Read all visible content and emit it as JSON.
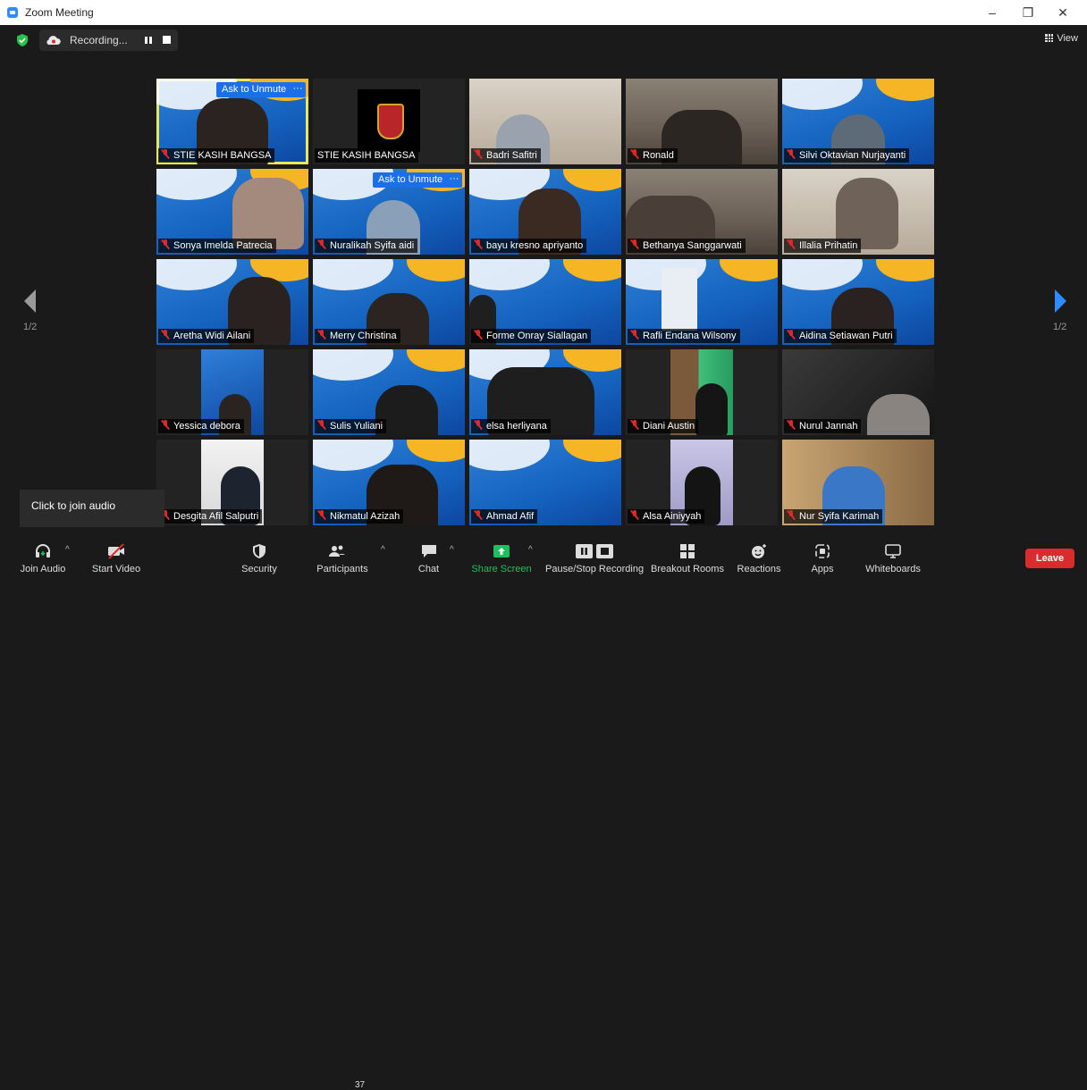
{
  "window": {
    "title": "Zoom Meeting",
    "controls": [
      "–",
      "❐",
      "✕"
    ]
  },
  "topbar": {
    "recording_label": "Recording...",
    "view_label": "View"
  },
  "pagination": {
    "left": "1/2",
    "right": "1/2"
  },
  "ask_to_unmute": "Ask to Unmute",
  "more": "···",
  "participants": [
    {
      "name": "STIE KASIH BANGSA",
      "muted": true
    },
    {
      "name": "STIE KASIH BANGSA",
      "muted": false
    },
    {
      "name": "Badri Safitri",
      "muted": true
    },
    {
      "name": "Ronald",
      "muted": true
    },
    {
      "name": "Silvi Oktavian Nurjayanti",
      "muted": true
    },
    {
      "name": "Sonya Imelda Patrecia",
      "muted": true
    },
    {
      "name": "Nuralikah Syifa aidi",
      "muted": true
    },
    {
      "name": "bayu kresno apriyanto",
      "muted": true
    },
    {
      "name": "Bethanya Sanggarwati",
      "muted": true
    },
    {
      "name": "Illalia Prihatin",
      "muted": true
    },
    {
      "name": "Aretha Widi Ailani",
      "muted": true
    },
    {
      "name": "Merry Christina",
      "muted": true
    },
    {
      "name": "Forme Onray Siallagan",
      "muted": true
    },
    {
      "name": "Rafli Endana Wilsony",
      "muted": true
    },
    {
      "name": "Aidina Setiawan Putri",
      "muted": true
    },
    {
      "name": "Yessica debora",
      "muted": true
    },
    {
      "name": "Sulis Yuliani",
      "muted": true
    },
    {
      "name": "elsa herliyana",
      "muted": true
    },
    {
      "name": "Diani Austin",
      "muted": true
    },
    {
      "name": "Nurul Jannah",
      "muted": true
    },
    {
      "name": "Desgita Afil Salputri",
      "muted": true
    },
    {
      "name": "Nikmatul Azizah",
      "muted": true
    },
    {
      "name": "Ahmad Afif",
      "muted": true
    },
    {
      "name": "Alsa Ainiyyah",
      "muted": true
    },
    {
      "name": "Nur Syifa Karimah",
      "muted": true
    }
  ],
  "tooltip": "Click to join audio",
  "toolbar": {
    "join_audio": "Join Audio",
    "start_video": "Start Video",
    "security": "Security",
    "participants": "Participants",
    "participants_count": "37",
    "chat": "Chat",
    "share_screen": "Share Screen",
    "recording": "Pause/Stop Recording",
    "breakout": "Breakout Rooms",
    "reactions": "Reactions",
    "apps": "Apps",
    "whiteboards": "Whiteboards",
    "leave": "Leave"
  },
  "colors": {
    "accent": "#2d8cff",
    "share_green": "#1fbf5f",
    "leave_red": "#d92c2c",
    "mute_red": "#e02828",
    "active_speaker": "#e8e85a"
  }
}
